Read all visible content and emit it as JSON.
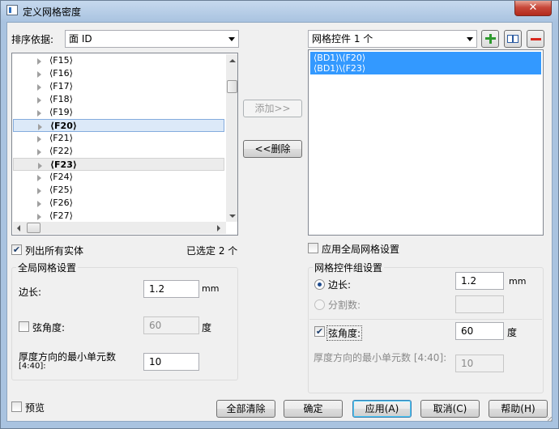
{
  "window": {
    "title": "定义网格密度"
  },
  "sort": {
    "label": "排序依据:",
    "value": "面 ID"
  },
  "tree": {
    "items": [
      {
        "label": "⟨F15⟩",
        "state": "normal"
      },
      {
        "label": "⟨F16⟩",
        "state": "normal"
      },
      {
        "label": "⟨F17⟩",
        "state": "normal"
      },
      {
        "label": "⟨F18⟩",
        "state": "normal"
      },
      {
        "label": "⟨F19⟩",
        "state": "normal"
      },
      {
        "label": "⟨F20⟩",
        "state": "selected"
      },
      {
        "label": "⟨F21⟩",
        "state": "normal"
      },
      {
        "label": "⟨F22⟩",
        "state": "normal"
      },
      {
        "label": "⟨F23⟩",
        "state": "selected-inactive"
      },
      {
        "label": "⟨F24⟩",
        "state": "normal"
      },
      {
        "label": "⟨F25⟩",
        "state": "normal"
      },
      {
        "label": "⟨F26⟩",
        "state": "normal"
      },
      {
        "label": "⟨F27⟩",
        "state": "normal"
      }
    ]
  },
  "buttons": {
    "add": "添加>>",
    "remove": "<<删除",
    "clear_all": "全部清除",
    "ok": "确定",
    "apply": "应用(A)",
    "cancel": "取消(C)",
    "help": "帮助(H)"
  },
  "list_all": {
    "label": "列出所有实体",
    "checked": true
  },
  "selected_count": "已选定 2 个",
  "mesh_control": {
    "combo_value": "网格控件 1 个",
    "items": [
      "⟨BD1⟩\\⟨F20⟩",
      "⟨BD1⟩\\⟨F23⟩"
    ]
  },
  "apply_global": {
    "label": "应用全局网格设置",
    "checked": false
  },
  "global": {
    "title": "全局网格设置",
    "edge_label": "边长:",
    "edge_value": "1.2",
    "edge_unit": "mm",
    "chord_label": "弦角度:",
    "chord_value": "60",
    "chord_unit": "度",
    "min_elems_label": "厚度方向的最小单元数",
    "min_elems_range": "[4:40]:",
    "min_elems_value": "10"
  },
  "group": {
    "title": "网格控件组设置",
    "edge_label": "边长:",
    "edge_value": "1.2",
    "edge_unit": "mm",
    "divisions_label": "分割数:",
    "divisions_value": "",
    "chord_label": "弦角度:",
    "chord_value": "60",
    "chord_unit": "度",
    "min_elems_label": "厚度方向的最小单元数 [4:40]:",
    "min_elems_value": "10"
  },
  "preview": {
    "label": "预览",
    "checked": false
  },
  "colors": {
    "selection": "#3399ff",
    "add_icon": "#2e9a2e",
    "remove_icon": "#d8271e"
  }
}
